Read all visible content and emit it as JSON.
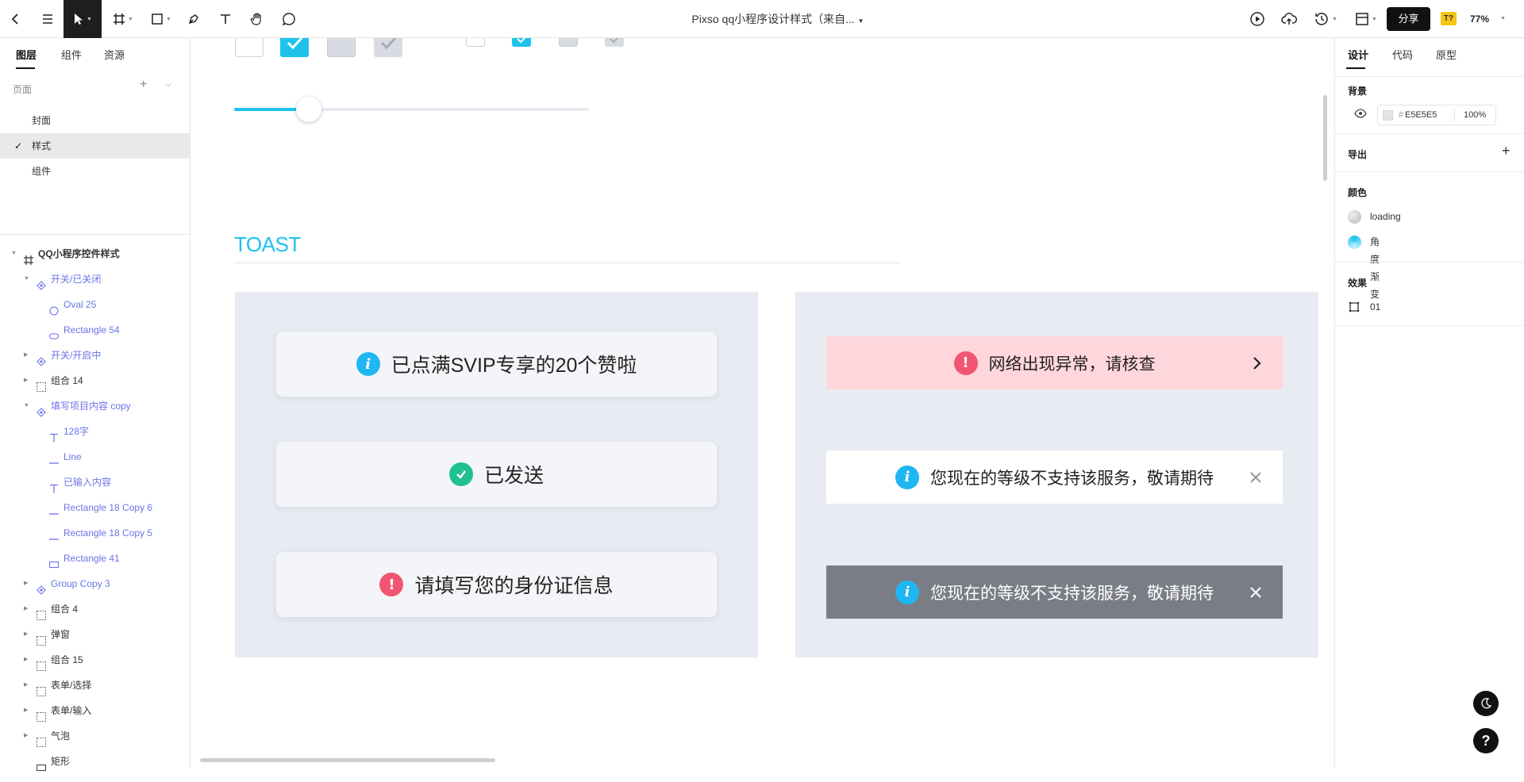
{
  "toolbar": {
    "document_title": "Pixso qq小程序设计样式（来自...",
    "share_label": "分享",
    "font_badge": "T?",
    "zoom": "77%"
  },
  "left_panel": {
    "tabs": [
      "图层",
      "组件",
      "资源"
    ],
    "pages_header": "页面",
    "pages": [
      {
        "label": "封面",
        "selected": false
      },
      {
        "label": "样式",
        "selected": true
      },
      {
        "label": "组件",
        "selected": false
      }
    ],
    "layers": [
      {
        "label": "QQ小程序控件样式",
        "icon": "frame-icon",
        "purple": false,
        "expanded": true
      },
      {
        "label": "开关/已关闭",
        "icon": "component-icon",
        "purple": true,
        "expanded": true
      },
      {
        "label": "Oval 25",
        "icon": "oval-icon",
        "purple": true
      },
      {
        "label": "Rectangle 54",
        "icon": "rounded-rect-icon",
        "purple": true
      },
      {
        "label": "开关/开启中",
        "icon": "component-icon",
        "purple": true,
        "expanded": false
      },
      {
        "label": "组合 14",
        "icon": "group-icon",
        "purple": false,
        "expanded": false
      },
      {
        "label": "填写项目内容 copy",
        "icon": "component-icon",
        "purple": true,
        "expanded": true
      },
      {
        "label": "128字",
        "icon": "text-icon",
        "purple": true
      },
      {
        "label": "Line",
        "icon": "line-icon",
        "purple": true
      },
      {
        "label": "已输入内容",
        "icon": "text-icon",
        "purple": true
      },
      {
        "label": "Rectangle 18 Copy 6",
        "icon": "line-icon",
        "purple": true
      },
      {
        "label": "Rectangle 18 Copy 5",
        "icon": "line-icon",
        "purple": true
      },
      {
        "label": "Rectangle 41",
        "icon": "rect-icon",
        "purple": true
      },
      {
        "label": "Group Copy 3",
        "icon": "component-icon",
        "purple": true,
        "expanded": false
      },
      {
        "label": "组合 4",
        "icon": "group-icon",
        "purple": false,
        "expanded": false
      },
      {
        "label": "弹窗",
        "icon": "group-icon",
        "purple": false,
        "expanded": false
      },
      {
        "label": "组合 15",
        "icon": "group-icon",
        "purple": false,
        "expanded": false
      },
      {
        "label": "表单/选择",
        "icon": "group-icon",
        "purple": false,
        "expanded": false
      },
      {
        "label": "表单/输入",
        "icon": "group-icon",
        "purple": false,
        "expanded": false
      },
      {
        "label": "气泡",
        "icon": "group-icon",
        "purple": false,
        "expanded": false
      },
      {
        "label": "矩形",
        "icon": "rect-icon",
        "purple": false
      }
    ]
  },
  "canvas": {
    "slider_value": 0.21,
    "section_title": "TOAST",
    "toasts_left": [
      {
        "text": "已点满SVIP专享的20个赞啦",
        "icon": "info-icon",
        "color": "#1fb6f2"
      },
      {
        "text": "已发送",
        "icon": "check-icon",
        "color": "#21c18f"
      },
      {
        "text": "请填写您的身份证信息",
        "icon": "alert-icon",
        "color": "#f25572"
      }
    ],
    "toasts_right": [
      {
        "text": "网络出现异常，请核查",
        "icon": "alert-icon",
        "color": "#f25572",
        "bg": "#ffd6db",
        "action": "chevron-right-icon"
      },
      {
        "text": "您现在的等级不支持该服务，敬请期待",
        "icon": "info-icon",
        "color": "#1fb6f2",
        "bg": "#ffffff",
        "action": "close-icon"
      },
      {
        "text": "您现在的等级不支持该服务，敬请期待",
        "icon": "info-icon",
        "color": "#1fb6f2",
        "bg": "#7a7d86",
        "action": "close-icon"
      }
    ],
    "accent": "#1ec3ec"
  },
  "right_panel": {
    "tabs": [
      "设计",
      "代码",
      "原型"
    ],
    "background": {
      "title": "背景",
      "hash": "#",
      "hex": "E5E5E5",
      "opacity": "100%"
    },
    "export": {
      "title": "导出"
    },
    "colors": {
      "title": "颜色",
      "items": [
        "loading",
        "角度渐变"
      ]
    },
    "effects": {
      "title": "效果",
      "items": [
        "01"
      ]
    }
  }
}
